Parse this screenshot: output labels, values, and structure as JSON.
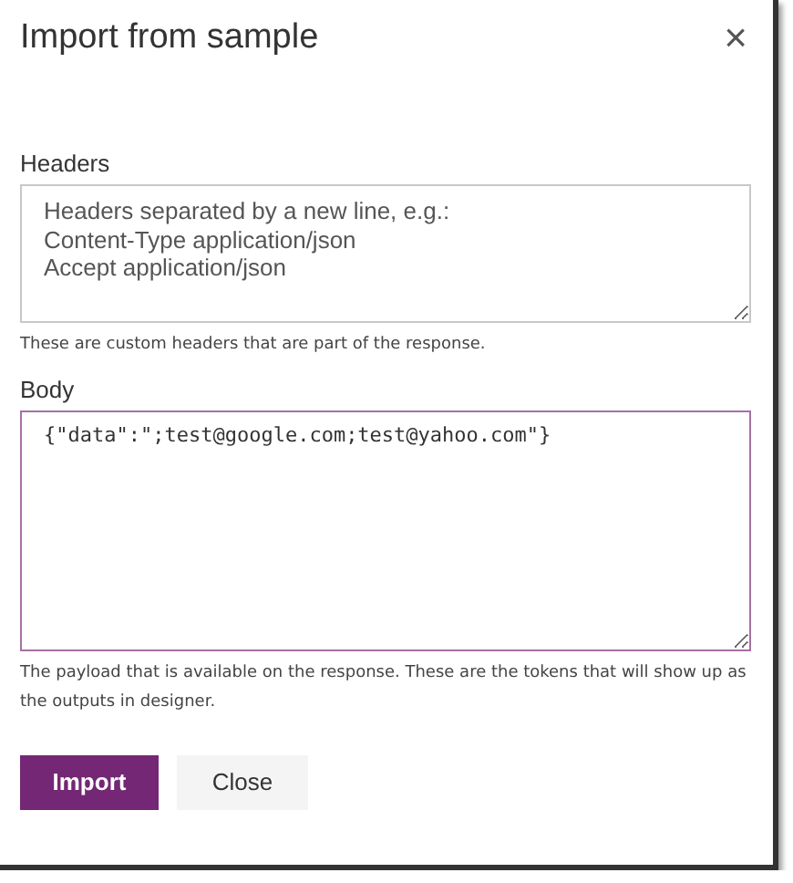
{
  "dialog": {
    "title": "Import from sample",
    "close_glyph": "×"
  },
  "fields": [
    {
      "label": "Headers",
      "placeholder": "Headers separated by a new line, e.g.:\nContent-Type application/json\nAccept application/json",
      "hint": "These are custom headers that are part of the response.",
      "focused": false,
      "kind": "text"
    },
    {
      "label": "Body",
      "value": "{\"data\":\";test@google.com;test@yahoo.com\"}",
      "hint": "The payload that is available on the response. These are the tokens that will show up as the outputs in designer.",
      "focused": true,
      "kind": "code"
    }
  ],
  "buttons": [
    {
      "label": "Import",
      "kind": "primary"
    },
    {
      "label": "Close",
      "kind": "secondary"
    }
  ]
}
